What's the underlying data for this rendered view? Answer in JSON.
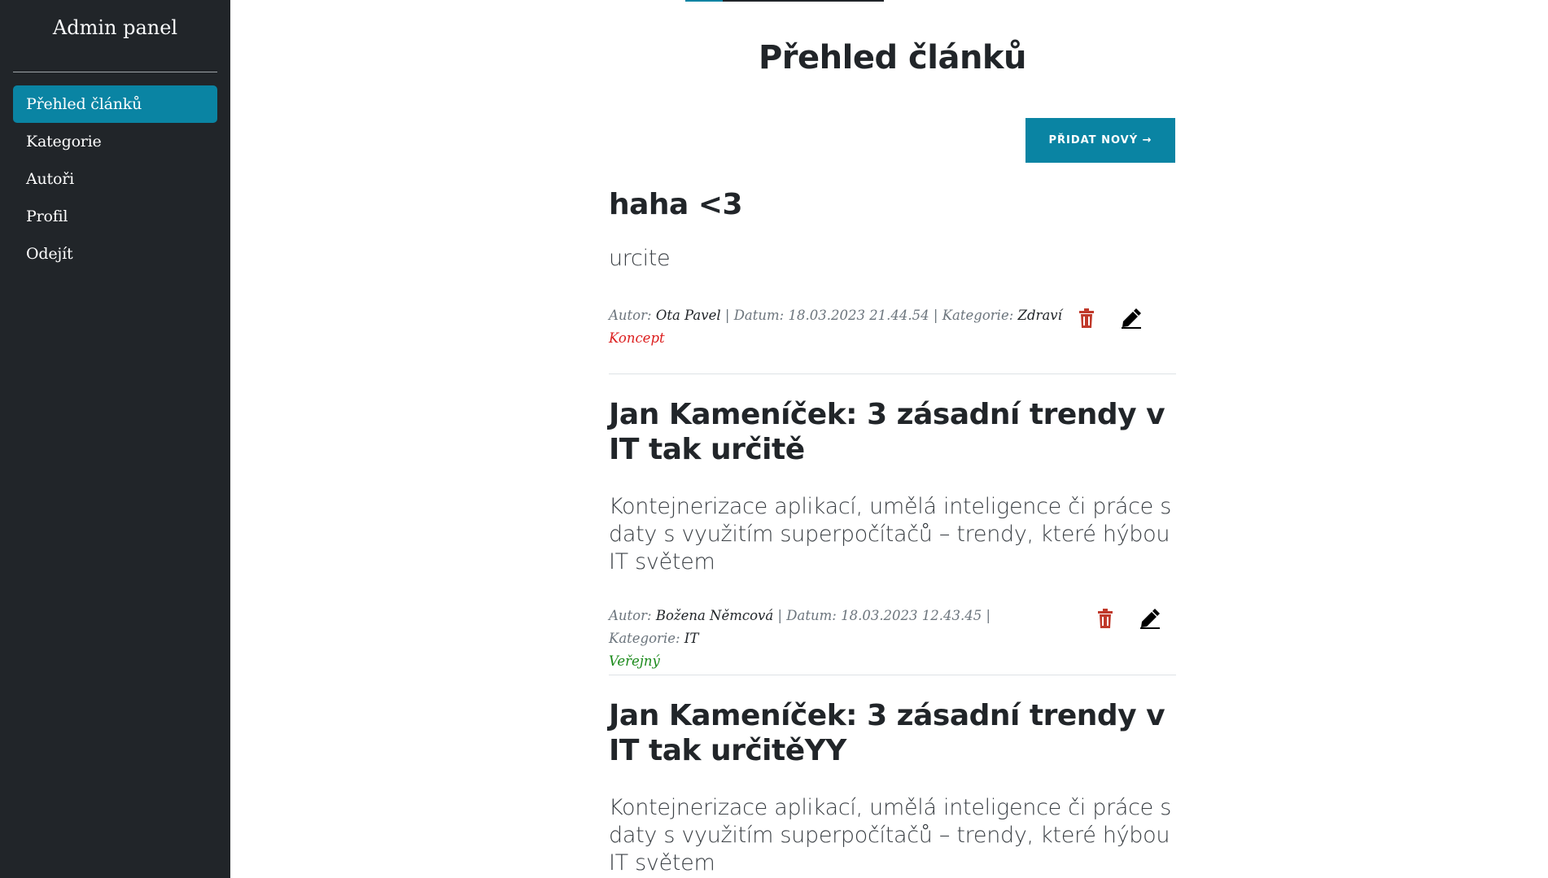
{
  "sidebar": {
    "brand": "Admin panel",
    "items": [
      {
        "label": "Přehled článků",
        "active": true
      },
      {
        "label": "Kategorie"
      },
      {
        "label": "Autoři"
      },
      {
        "label": "Profil"
      },
      {
        "label": "Odejít"
      }
    ]
  },
  "main": {
    "title": "Přehled článků",
    "add_button": "PŘIDAT NOVÝ →"
  },
  "articles": [
    {
      "title": "haha <3",
      "perex": "urcite",
      "author_label": "Autor:",
      "author": "Ota Pavel",
      "date_label": "Datum:",
      "date": "18.03.2023 21.44.54",
      "category_label": "Kategorie:",
      "category": "Zdraví",
      "status": "Koncept"
    },
    {
      "title": "Jan Kameníček: 3 zásadní trendy v IT tak určitě",
      "perex": "Kontejnerizace aplikací, umělá inteligence či práce s daty s využitím superpočítačů – trendy, které hýbou IT světem",
      "author_label": "Autor:",
      "author": "Božena Němcová",
      "date_label": "Datum:",
      "date": "18.03.2023 12.43.45",
      "category_label": "Kategorie:",
      "category": "IT",
      "status": "Veřejný"
    },
    {
      "title": "Jan Kameníček: 3 zásadní trendy v IT tak určitěYY",
      "perex": "Kontejnerizace aplikací, umělá inteligence či práce s daty s využitím superpočítačů – trendy, které hýbou IT světem"
    }
  ],
  "colors": {
    "sidebar_bg": "#212529",
    "accent": "#0a84a3",
    "delete_icon": "#c0392b",
    "status_draft": "#dc1f1f",
    "status_public": "#1b8a1b"
  },
  "icons": [
    "trash-icon",
    "pencil-icon"
  ]
}
